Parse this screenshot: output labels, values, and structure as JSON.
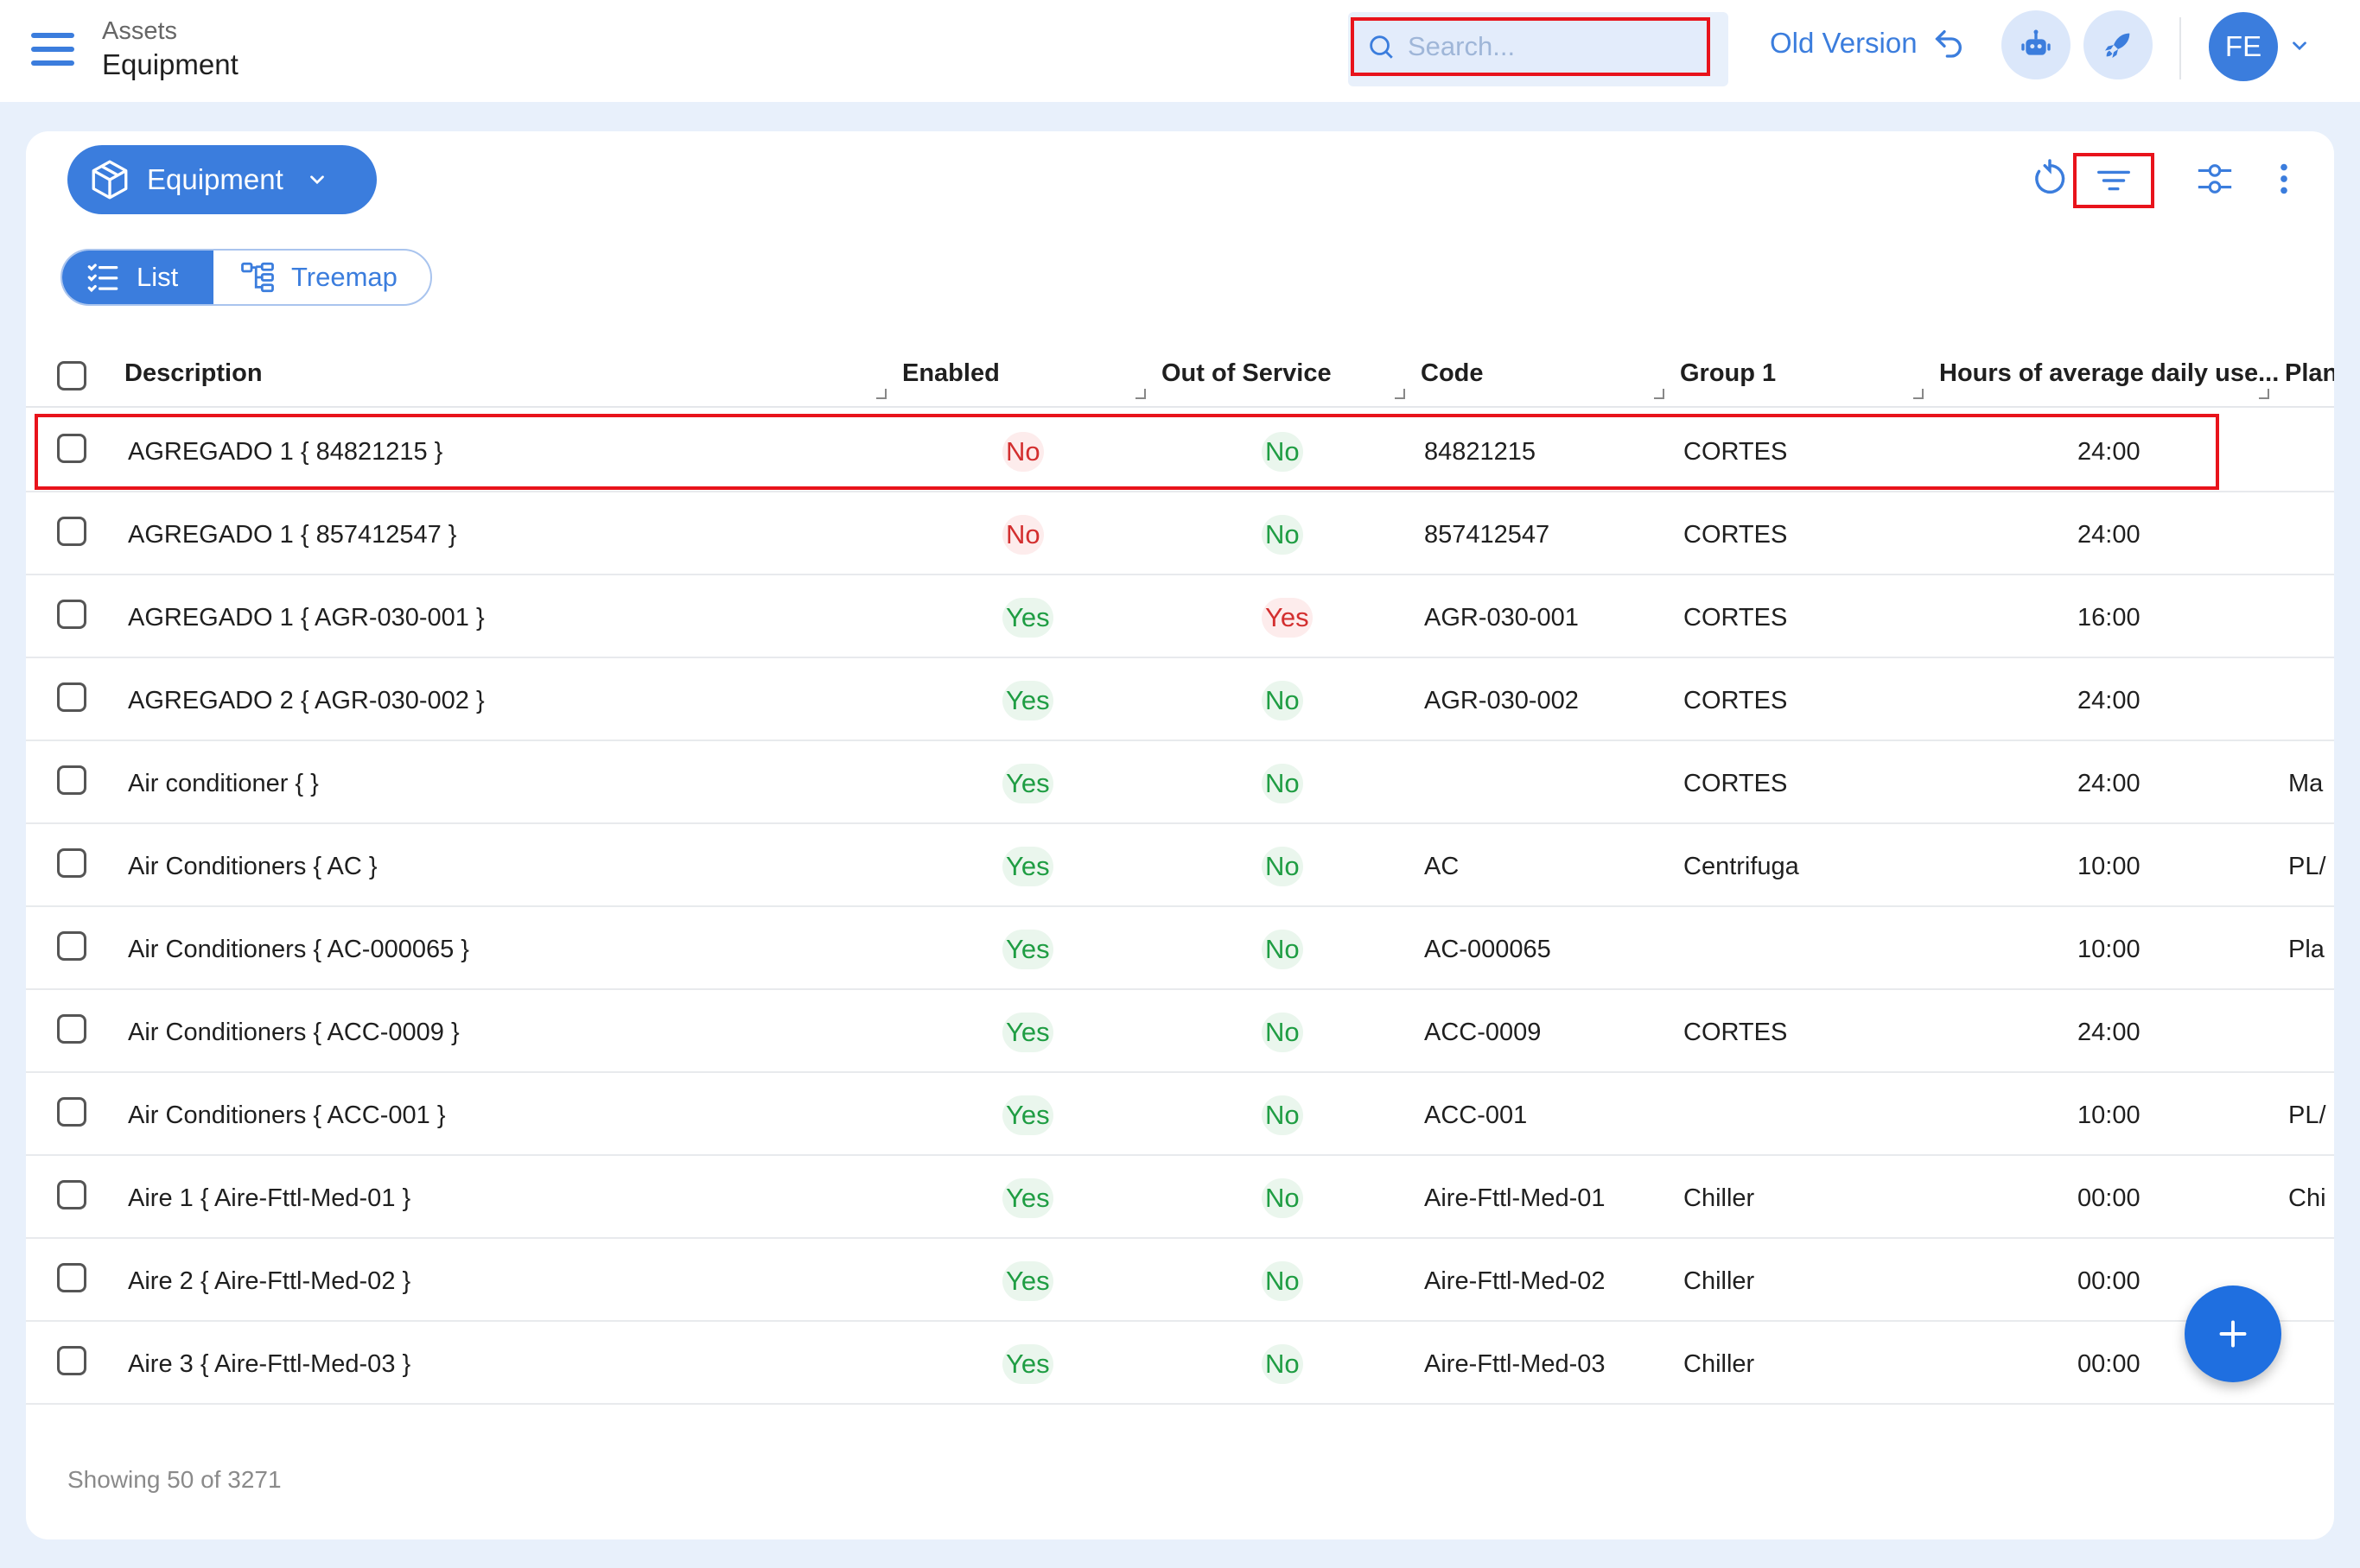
{
  "header": {
    "breadcrumb_parent": "Assets",
    "breadcrumb_current": "Equipment",
    "search_placeholder": "Search...",
    "old_version_label": "Old Version",
    "avatar_initials": "FE"
  },
  "toolbar": {
    "equipment_label": "Equipment",
    "views": {
      "list": "List",
      "treemap": "Treemap",
      "active": "list"
    }
  },
  "table": {
    "columns": [
      "Description",
      "Enabled",
      "Out of Service",
      "Code",
      "Group 1",
      "Hours of average daily use...",
      "Plan"
    ],
    "rows": [
      {
        "description": "AGREGADO 1 { 84821215 }",
        "enabled": "No",
        "out_of_service": "No",
        "code": "84821215",
        "group1": "CORTES",
        "hours": "24:00",
        "plan": "",
        "highlighted": true
      },
      {
        "description": "AGREGADO 1 { 857412547 }",
        "enabled": "No",
        "out_of_service": "No",
        "code": "857412547",
        "group1": "CORTES",
        "hours": "24:00",
        "plan": ""
      },
      {
        "description": "AGREGADO 1 { AGR-030-001 }",
        "enabled": "Yes",
        "out_of_service": "Yes",
        "code": "AGR-030-001",
        "group1": "CORTES",
        "hours": "16:00",
        "plan": ""
      },
      {
        "description": "AGREGADO 2 { AGR-030-002 }",
        "enabled": "Yes",
        "out_of_service": "No",
        "code": "AGR-030-002",
        "group1": "CORTES",
        "hours": "24:00",
        "plan": ""
      },
      {
        "description": "Air conditioner { }",
        "enabled": "Yes",
        "out_of_service": "No",
        "code": "",
        "group1": "CORTES",
        "hours": "24:00",
        "plan": "Ma"
      },
      {
        "description": "Air Conditioners { AC }",
        "enabled": "Yes",
        "out_of_service": "No",
        "code": "AC",
        "group1": "Centrifuga",
        "hours": "10:00",
        "plan": "PL/"
      },
      {
        "description": "Air Conditioners { AC-000065 }",
        "enabled": "Yes",
        "out_of_service": "No",
        "code": "AC-000065",
        "group1": "",
        "hours": "10:00",
        "plan": "Pla"
      },
      {
        "description": "Air Conditioners { ACC-0009 }",
        "enabled": "Yes",
        "out_of_service": "No",
        "code": "ACC-0009",
        "group1": "CORTES",
        "hours": "24:00",
        "plan": ""
      },
      {
        "description": "Air Conditioners { ACC-001 }",
        "enabled": "Yes",
        "out_of_service": "No",
        "code": "ACC-001",
        "group1": "",
        "hours": "10:00",
        "plan": "PL/"
      },
      {
        "description": "Aire 1 { Aire-Fttl-Med-01 }",
        "enabled": "Yes",
        "out_of_service": "No",
        "code": "Aire-Fttl-Med-01",
        "group1": "Chiller",
        "hours": "00:00",
        "plan": "Chi"
      },
      {
        "description": "Aire 2 { Aire-Fttl-Med-02 }",
        "enabled": "Yes",
        "out_of_service": "No",
        "code": "Aire-Fttl-Med-02",
        "group1": "Chiller",
        "hours": "00:00",
        "plan": ""
      },
      {
        "description": "Aire 3 { Aire-Fttl-Med-03 }",
        "enabled": "Yes",
        "out_of_service": "No",
        "code": "Aire-Fttl-Med-03",
        "group1": "Chiller",
        "hours": "00:00",
        "plan": ""
      }
    ]
  },
  "footer": {
    "showing": "Showing 50 of 3271"
  },
  "icons": {
    "menu": "menu-icon",
    "search": "search-icon",
    "undo": "undo-icon",
    "robot": "robot-icon",
    "rocket": "rocket-icon",
    "refresh": "refresh-icon",
    "filter": "filter-icon",
    "settings": "sliders-icon",
    "more": "more-vertical-icon",
    "cube": "cube-icon",
    "add": "plus-icon"
  },
  "colors": {
    "accent": "#3b7ddd",
    "yes": "#1f9d43",
    "no": "#d32f2f",
    "highlight": "#e8131b"
  }
}
